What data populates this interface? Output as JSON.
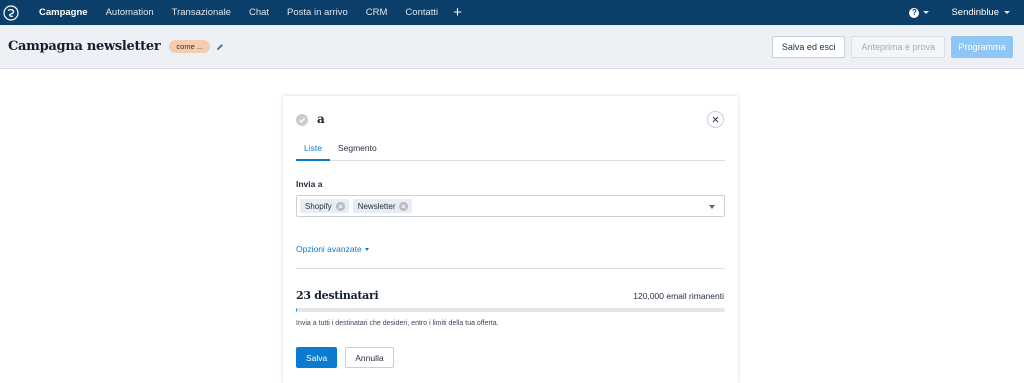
{
  "colors": {
    "nav_bg": "#0b3f69",
    "header_bg": "#edf0f5",
    "accent": "#0b7ad1",
    "badge_bg": "#f5ccb0",
    "schedule_btn_bg": "#8fc6f5"
  },
  "nav": {
    "logo_icon": "sendinblue-logo-icon",
    "items": [
      {
        "label": "Campagne",
        "active": true
      },
      {
        "label": "Automation"
      },
      {
        "label": "Transazionale"
      },
      {
        "label": "Chat"
      },
      {
        "label": "Posta in arrivo"
      },
      {
        "label": "CRM"
      },
      {
        "label": "Contatti"
      }
    ],
    "add_icon": "plus-icon",
    "help_icon": "question-circle-icon",
    "account_name": "Sendinblue"
  },
  "header": {
    "title": "Campagna newsletter",
    "status_badge": "come ...",
    "edit_icon": "pencil-icon",
    "save_exit_label": "Salva ed esci",
    "preview_label": "Anteprima e prova",
    "schedule_label": "Programma"
  },
  "card": {
    "title": "a",
    "tabs": [
      {
        "label": "Liste",
        "active": true
      },
      {
        "label": "Segmento"
      }
    ],
    "send_to_label": "Invia a",
    "selected_lists": [
      "Shopify",
      "Newsletter"
    ],
    "advanced_options_label": "Opzioni avanzate",
    "recipients_label": "23 destinatari",
    "remaining_label": "120,000 email rimanenti",
    "progress_fraction": 0.002,
    "help_text": "Invia a tutti i destinatari che desideri, entro i limiti della tua offerta.",
    "save_label": "Salva",
    "cancel_label": "Annulla"
  }
}
